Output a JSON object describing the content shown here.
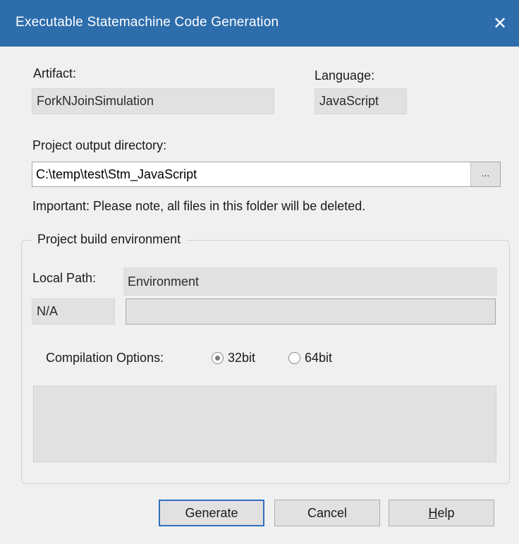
{
  "window": {
    "title": "Executable Statemachine Code Generation",
    "close_glyph": "✕"
  },
  "artifact": {
    "label": "Artifact:",
    "value": "ForkNJoinSimulation"
  },
  "language": {
    "label": "Language:",
    "value": "JavaScript"
  },
  "output_dir": {
    "label": "Project output directory:",
    "value": "C:\\temp\\test\\Stm_JavaScript",
    "browse_label": "...",
    "note": "Important: Please note, all files in this folder will be deleted."
  },
  "build_env": {
    "legend": "Project build environment",
    "local_path_header": "Local Path:",
    "environment_header": "Environment",
    "local_path_value": "N/A",
    "environment_value": "",
    "compilation_label": "Compilation Options:",
    "options": [
      {
        "label": "32bit",
        "selected": true
      },
      {
        "label": "64bit",
        "selected": false
      }
    ]
  },
  "buttons": {
    "generate": "Generate",
    "cancel": "Cancel",
    "help_underlined": "H",
    "help_rest": "elp"
  },
  "colors": {
    "titlebar": "#2d6dac",
    "dialog_bg": "#f0f0f0",
    "readonly_field": "#e1e1e1",
    "default_button_border": "#2f6fbf"
  },
  "icons": {
    "close": "close-icon",
    "radio": "radio-button-icon"
  }
}
